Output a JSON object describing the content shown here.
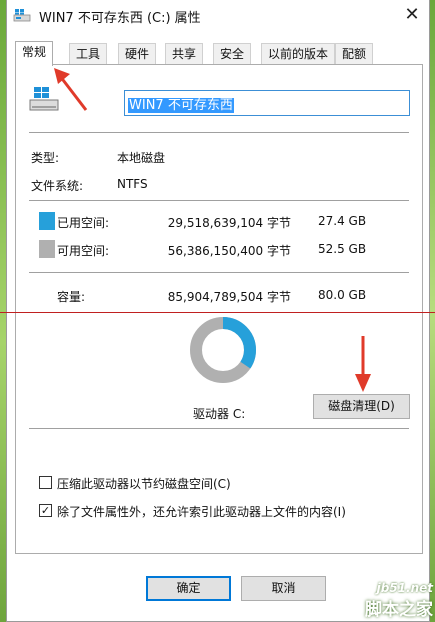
{
  "window": {
    "title": "WIN7 不可存东西 (C:) 属性",
    "close_glyph": "✕"
  },
  "tabs": [
    {
      "label": "常规",
      "active": true
    },
    {
      "label": "工具"
    },
    {
      "label": "硬件"
    },
    {
      "label": "共享"
    },
    {
      "label": "安全"
    },
    {
      "label": "以前的版本"
    },
    {
      "label": "配额"
    }
  ],
  "drive_name": "WIN7 不可存东西",
  "info": {
    "type_label": "类型:",
    "type_value": "本地磁盘",
    "fs_label": "文件系统:",
    "fs_value": "NTFS"
  },
  "space": {
    "used": {
      "label": "已用空间:",
      "bytes": "29,518,639,104 字节",
      "size": "27.4 GB",
      "color": "#26a0da"
    },
    "free": {
      "label": "可用空间:",
      "bytes": "56,386,150,400 字节",
      "size": "52.5 GB",
      "color": "#b0b0b0"
    },
    "capacity": {
      "label": "容量:",
      "bytes": "85,904,789,504 字节",
      "size": "80.0 GB"
    },
    "used_fraction": 0.344
  },
  "drive_caption": "驱动器 C:",
  "cleanup_button": "磁盘清理(D)",
  "options": [
    {
      "label": "压缩此驱动器以节约磁盘空间(C)",
      "checked": false
    },
    {
      "label": "除了文件属性外，还允许索引此驱动器上文件的内容(I)",
      "checked": true
    }
  ],
  "buttons": {
    "ok": "确定",
    "cancel": "取消"
  },
  "check_glyph": "✓",
  "watermark": {
    "url": "jb51.net",
    "name": "脚本之家"
  }
}
